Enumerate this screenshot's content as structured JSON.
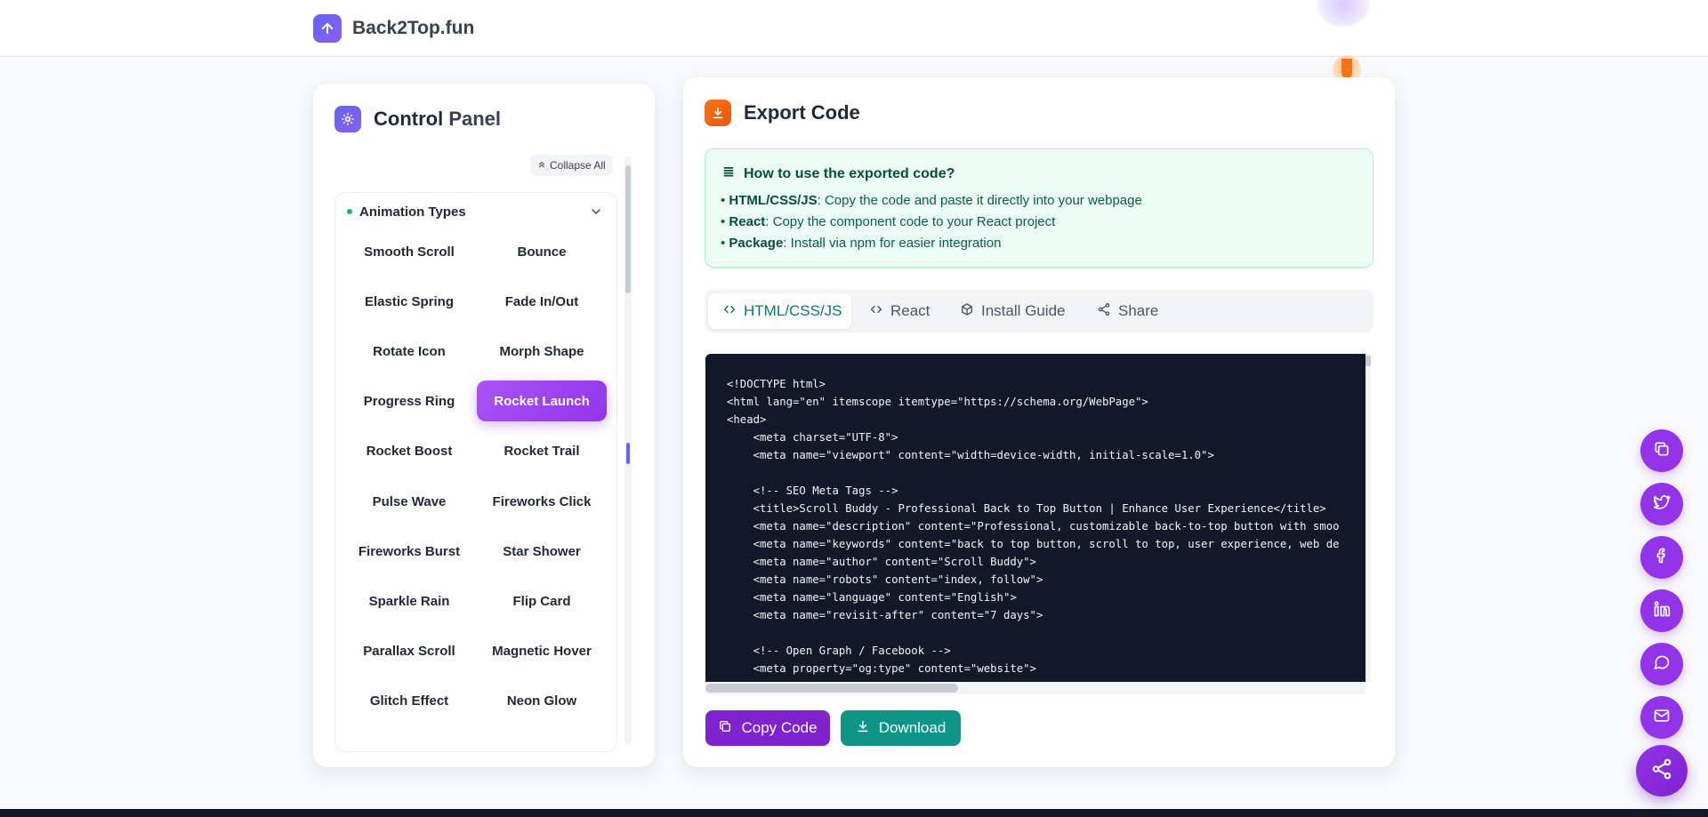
{
  "brand": {
    "name": "Back2Top.fun"
  },
  "control_panel": {
    "title_part1": "Control",
    "title_part2": "Panel",
    "collapse_label": "Collapse All",
    "section_title": "Animation Types",
    "animations": [
      "Smooth Scroll",
      "Bounce",
      "Elastic Spring",
      "Fade In/Out",
      "Rotate Icon",
      "Morph Shape",
      "Progress Ring",
      "Rocket Launch",
      "Rocket Boost",
      "Rocket Trail",
      "Pulse Wave",
      "Fireworks Click",
      "Fireworks Burst",
      "Star Shower",
      "Sparkle Rain",
      "Flip Card",
      "Parallax Scroll",
      "Magnetic Hover",
      "Glitch Effect",
      "Neon Glow"
    ],
    "active_animation": "Rocket Launch"
  },
  "export": {
    "title": "Export Code",
    "info_title": "How to use the exported code?",
    "info_lines": [
      {
        "label": "HTML/CSS/JS",
        "text": ": Copy the code and paste it directly into your webpage"
      },
      {
        "label": "React",
        "text": ": Copy the component code to your React project"
      },
      {
        "label": "Package",
        "text": ": Install via npm for easier integration"
      }
    ],
    "tabs": [
      "HTML/CSS/JS",
      "React",
      "Install Guide",
      "Share"
    ],
    "active_tab": "HTML/CSS/JS",
    "code": "<!DOCTYPE html>\n<html lang=\"en\" itemscope itemtype=\"https://schema.org/WebPage\">\n<head>\n    <meta charset=\"UTF-8\">\n    <meta name=\"viewport\" content=\"width=device-width, initial-scale=1.0\">\n\n    <!-- SEO Meta Tags -->\n    <title>Scroll Buddy - Professional Back to Top Button | Enhance User Experience</title>\n    <meta name=\"description\" content=\"Professional, customizable back-to-top button with smoo\n    <meta name=\"keywords\" content=\"back to top button, scroll to top, user experience, web de\n    <meta name=\"author\" content=\"Scroll Buddy\">\n    <meta name=\"robots\" content=\"index, follow\">\n    <meta name=\"language\" content=\"English\">\n    <meta name=\"revisit-after\" content=\"7 days\">\n\n    <!-- Open Graph / Facebook -->\n    <meta property=\"og:type\" content=\"website\">",
    "copy_label": "Copy Code",
    "download_label": "Download"
  },
  "share_bar": {
    "icons": [
      "copy-icon",
      "twitter-icon",
      "facebook-icon",
      "linkedin-icon",
      "chat-icon",
      "mail-icon"
    ],
    "main_icon": "share-icon"
  },
  "colors": {
    "accent_purple": "#9333ea",
    "accent_teal": "#0f9488",
    "brand_indigo": "#6366f1",
    "export_orange": "#f97316"
  }
}
